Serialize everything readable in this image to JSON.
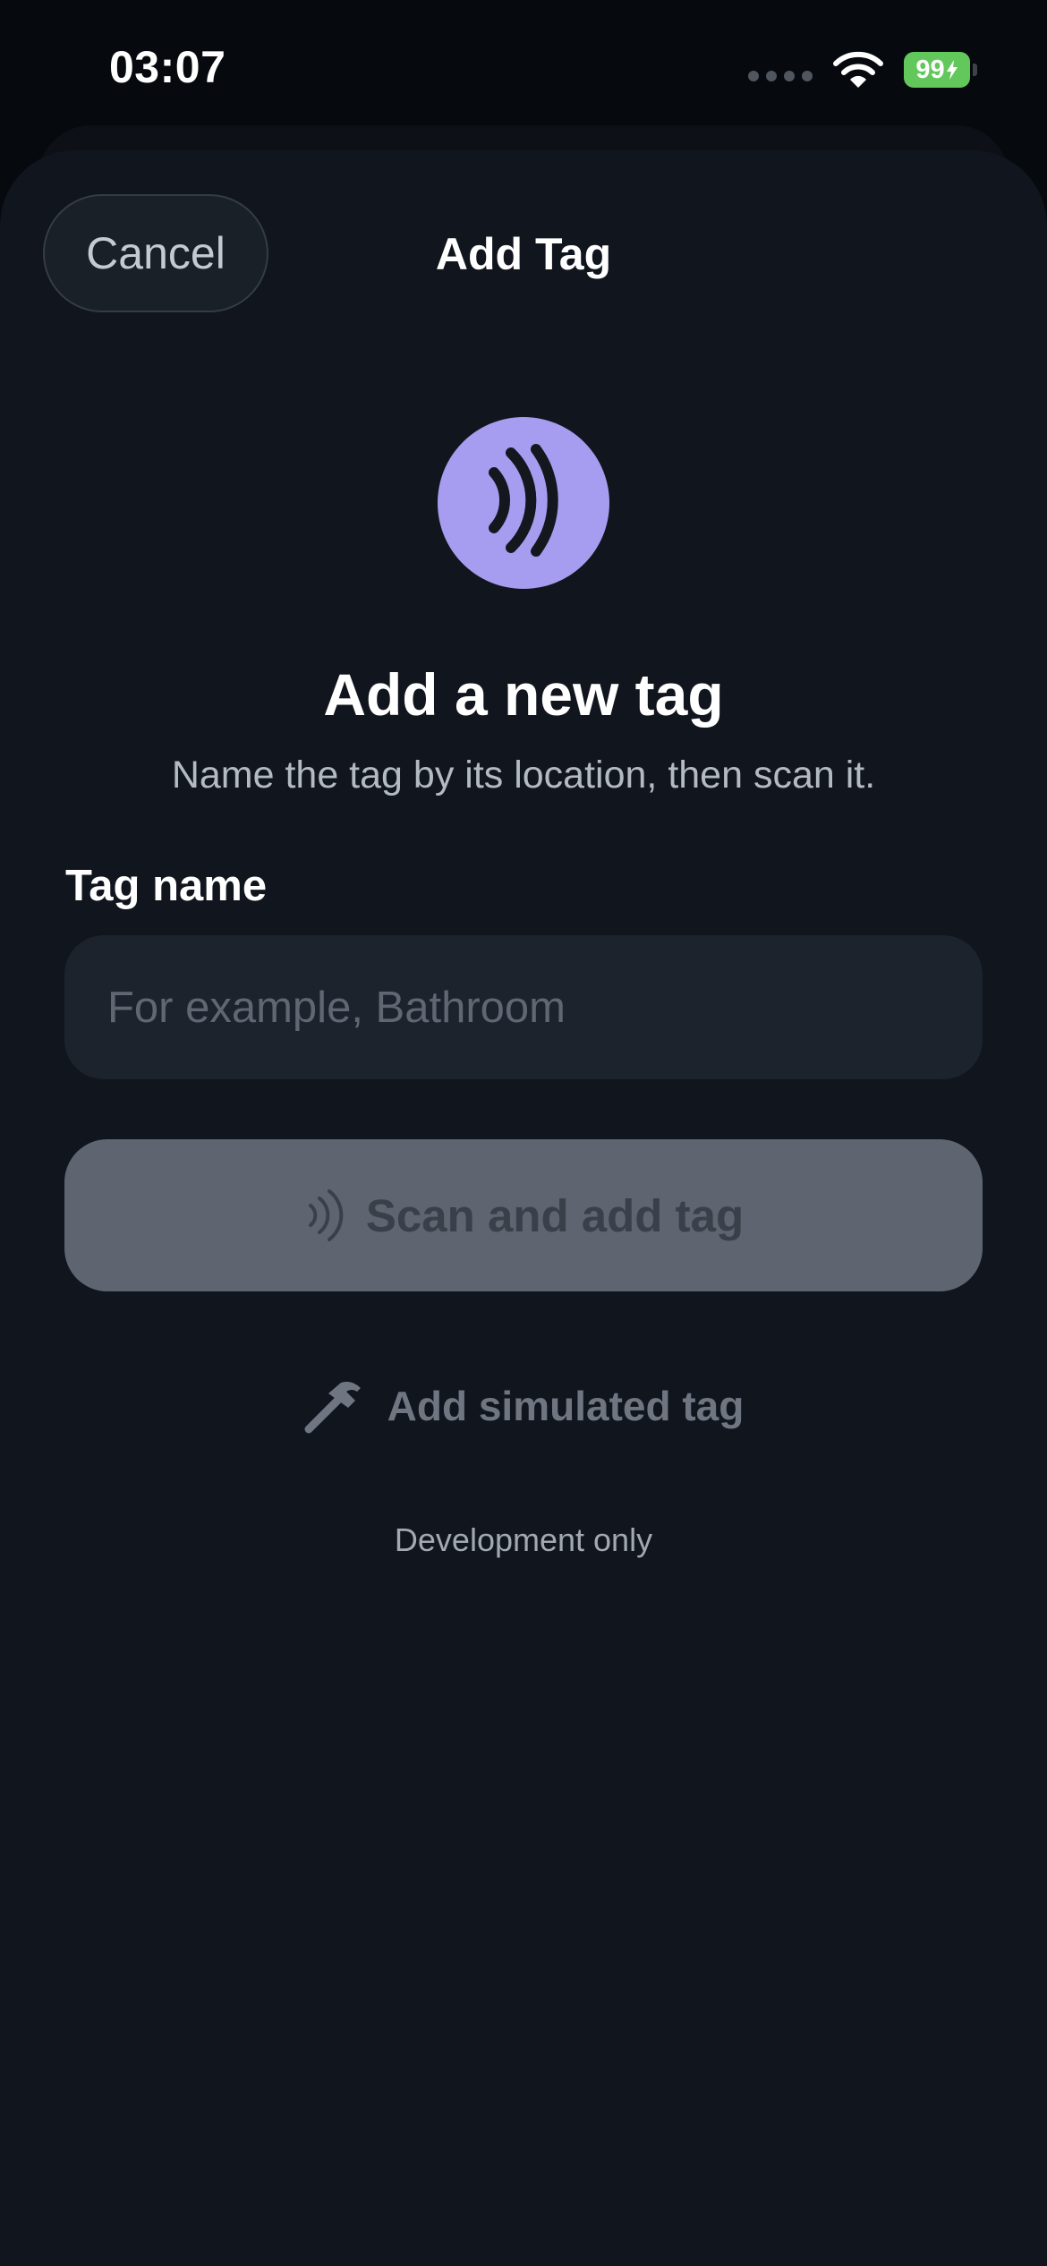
{
  "status_bar": {
    "time": "03:07",
    "battery_level": "99",
    "icons": [
      "cellular-signal-icon",
      "wifi-icon",
      "battery-charging-icon"
    ]
  },
  "header": {
    "cancel_label": "Cancel",
    "title": "Add Tag"
  },
  "hero": {
    "icon": "nfc-signal-icon",
    "title": "Add a new tag",
    "subtitle": "Name the tag by its location, then scan it."
  },
  "form": {
    "field_label": "Tag name",
    "input_value": "",
    "input_placeholder": "For example, Bathroom"
  },
  "actions": {
    "scan_label": "Scan and add tag",
    "scan_icon": "nfc-signal-icon",
    "simulated_label": "Add simulated tag",
    "simulated_icon": "hammer-icon",
    "dev_note": "Development only"
  },
  "colors": {
    "background": "#11151d",
    "accent": "#a79df0",
    "battery": "#62c85c",
    "disabled_button": "#5e6570",
    "input_background": "#1c232d"
  }
}
